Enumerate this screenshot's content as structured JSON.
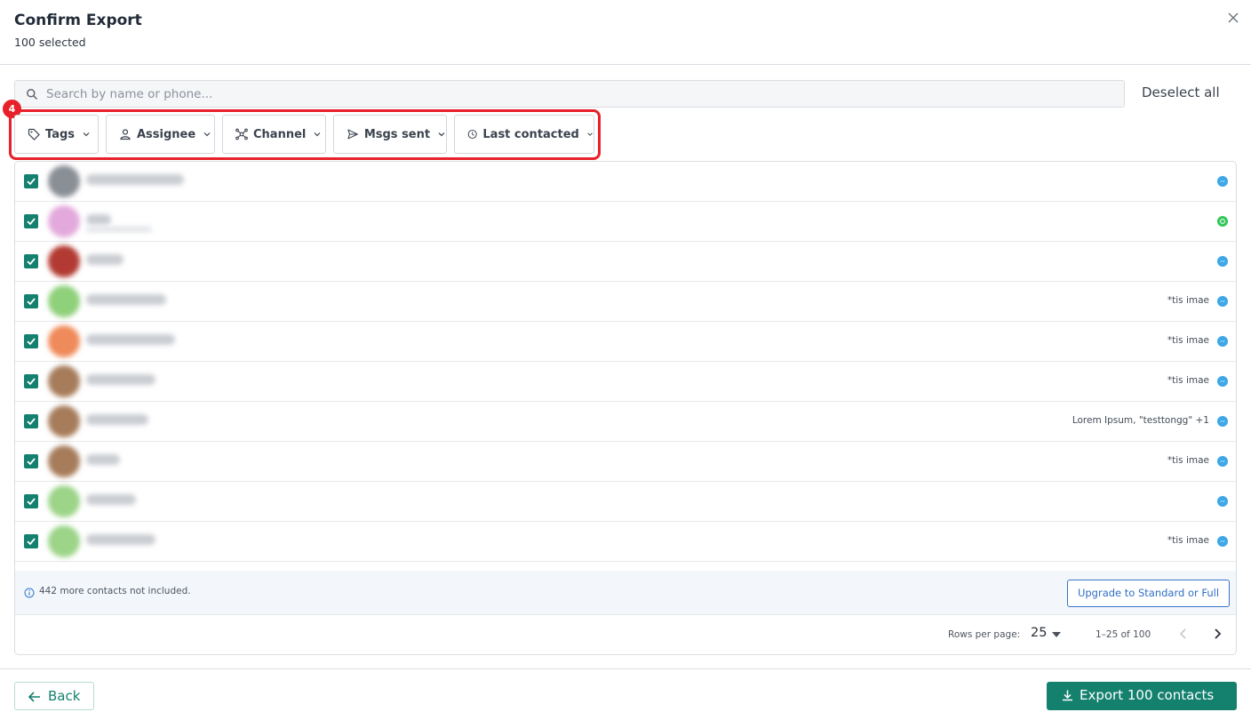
{
  "dialog": {
    "title": "Confirm Export",
    "subtitle": "100 selected",
    "close_icon": "close-icon"
  },
  "search": {
    "placeholder": "Search by name or phone...",
    "value": "",
    "icon": "search-icon"
  },
  "deselect_label": "Deselect all",
  "annotation_badge": "4",
  "filters": [
    {
      "label": "Tags",
      "icon": "tag-icon"
    },
    {
      "label": "Assignee",
      "icon": "person-icon"
    },
    {
      "label": "Channel",
      "icon": "network-icon"
    },
    {
      "label": "Msgs sent",
      "icon": "send-icon"
    },
    {
      "label": "Last contacted",
      "icon": "clock-icon"
    }
  ],
  "rows": [
    {
      "checked": true,
      "avatar_color": "#8a8f96",
      "channel": "messenger",
      "tags": ""
    },
    {
      "checked": true,
      "avatar_color": "#e3a9dc",
      "channel": "whatsapp",
      "tags": ""
    },
    {
      "checked": true,
      "avatar_color": "#b23a32",
      "channel": "messenger",
      "tags": ""
    },
    {
      "checked": true,
      "avatar_color": "#8fd07a",
      "channel": "messenger",
      "tags": "*tis imae"
    },
    {
      "checked": true,
      "avatar_color": "#ef8a5a",
      "channel": "messenger",
      "tags": "*tis imae"
    },
    {
      "checked": true,
      "avatar_color": "#a67c5b",
      "channel": "messenger",
      "tags": "*tis imae"
    },
    {
      "checked": true,
      "avatar_color": "#a67c5b",
      "channel": "messenger",
      "tags": "Lorem Ipsum, \"testtongg\" +1"
    },
    {
      "checked": true,
      "avatar_color": "#a67c5b",
      "channel": "messenger",
      "tags": "*tis imae"
    },
    {
      "checked": true,
      "avatar_color": "#9cd488",
      "channel": "messenger",
      "tags": ""
    },
    {
      "checked": true,
      "avatar_color": "#9cd488",
      "channel": "messenger",
      "tags": "*tis imae"
    }
  ],
  "channel_colors": {
    "messenger": "#3ba7e6",
    "whatsapp": "#34c759"
  },
  "notice": {
    "icon": "info-icon",
    "text": "442 more contacts not included.",
    "upgrade_label": "Upgrade to Standard or Full"
  },
  "pagination": {
    "rows_per_page_label": "Rows per page:",
    "rows_per_page_value": "25",
    "range_text": "1–25 of 100"
  },
  "footer": {
    "back_label": "Back",
    "export_label": "Export 100 contacts"
  },
  "colors": {
    "accent": "#14806e",
    "highlight": "#e8202a",
    "link": "#2f6ec4"
  }
}
